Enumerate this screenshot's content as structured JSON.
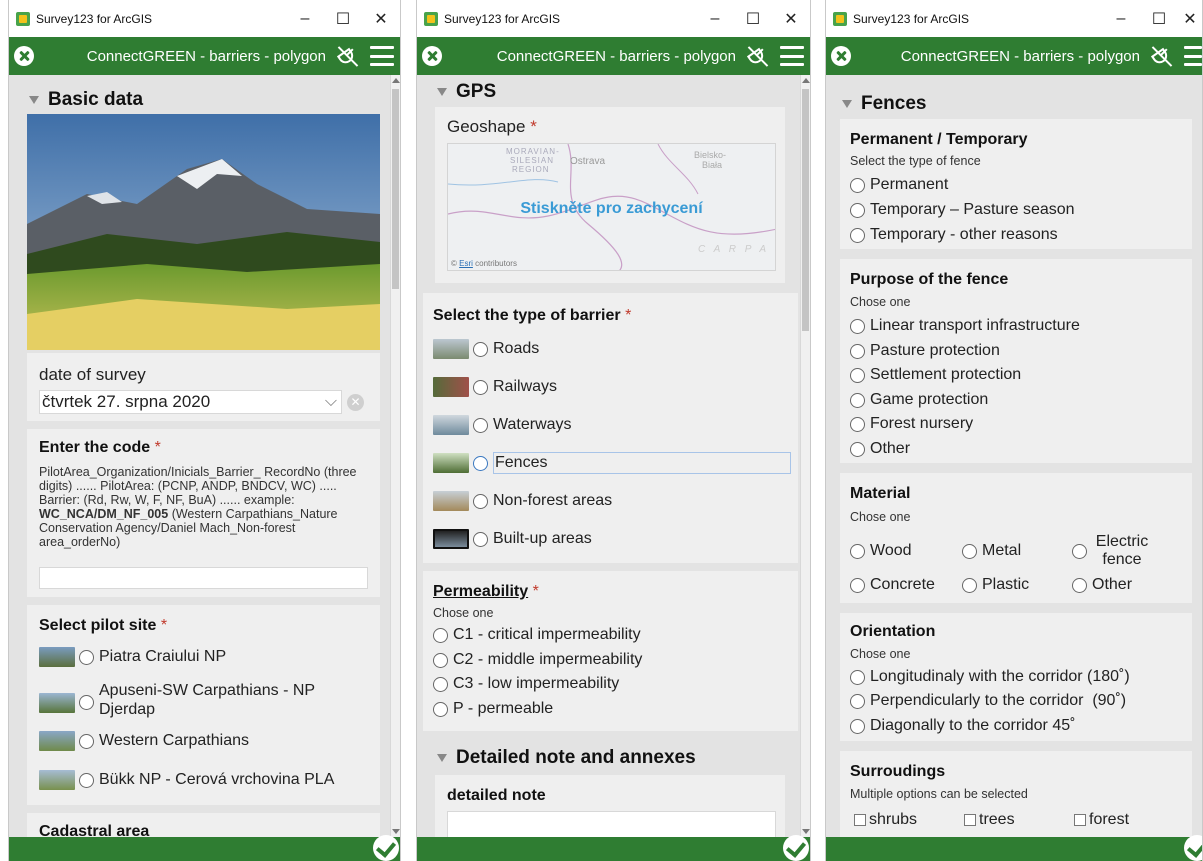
{
  "window1": {
    "title": "Survey123 for ArcGIS",
    "form_title": "ConnectGREEN - barriers - polygon",
    "group_basic": "Basic data",
    "date_label": "date of survey",
    "date_value": "čtvrtek 27. srpna 2020",
    "code_title": "Enter the code",
    "code_hint_1": "PilotArea_Organization/Inicials_Barrier_ RecordNo (three digits) ...... PilotArea: (PCNP, ANDP, BNDCV, WC) ..... Barrier: (Rd, Rw, W, F, NF, BuA) ...... example:",
    "code_hint_bold": "WC_NCA/DM_NF_005",
    "code_hint_2": "(Western Carpathians_Nature Conservation Agency/Daniel Mach_Non-forest area_orderNo)",
    "pilot_title": "Select pilot site",
    "pilot_options": [
      "Piatra Craiului NP",
      "Apuseni-SW Carpathians - NP Djerdap",
      "Western Carpathians",
      "Bükk NP - Cerová vrchovina PLA"
    ],
    "cadastral_label": "Cadastral area"
  },
  "window2": {
    "title": "Survey123 for ArcGIS",
    "form_title": "ConnectGREEN - barriers - polygon",
    "group_gps": "GPS",
    "geoshape_label": "Geoshape",
    "map_tap_text": "Stiskněte pro zachycení",
    "map_labels": [
      "MORAVIAN-",
      "SILESIAN",
      "REGION",
      "Ostrava",
      "Bielsko-",
      "Biała",
      "C A R P A"
    ],
    "map_credit_esri": "Esri",
    "map_credit_rest": "contributors",
    "barrier_title": "Select the type of barrier",
    "barrier_options": [
      "Roads",
      "Railways",
      "Waterways",
      "Fences",
      "Non-forest areas",
      "Built-up areas"
    ],
    "perm_title": "Permeability",
    "perm_hint": "Chose one",
    "perm_options": [
      "C1 - critical impermeability",
      "C2 - middle impermeability",
      "C3 - low impermeability",
      "P - permeable"
    ],
    "group_notes": "Detailed note and annexes",
    "note_label": "detailed note"
  },
  "window3": {
    "title": "Survey123 for ArcGIS",
    "form_title": "ConnectGREEN - barriers - polygon",
    "group_fences": "Fences",
    "pt_title": "Permanent / Temporary",
    "pt_hint": "Select the type of fence",
    "pt_options": [
      "Permanent",
      "Temporary – Pasture season",
      "Temporary - other reasons"
    ],
    "purpose_title": "Purpose of the fence",
    "purpose_hint": "Chose one",
    "purpose_options": [
      "Linear transport infrastructure",
      "Pasture protection",
      "Settlement protection",
      "Game protection",
      "Forest nursery",
      "Other"
    ],
    "material_title": "Material",
    "material_hint": "Chose one",
    "material_options": [
      "Wood",
      "Metal",
      "Electric fence",
      "Concrete",
      "Plastic",
      "Other"
    ],
    "orient_title": "Orientation",
    "orient_hint": "Chose one",
    "orient_options": [
      "Longitudinaly with the corridor (180˚)",
      "Perpendicularly to the corridor  (90˚)",
      "Diagonally to the corridor 45˚"
    ],
    "surr_title": "Surroudings",
    "surr_hint": "Multiple options can be selected",
    "surr_options": [
      "shrubs",
      "trees",
      "forest"
    ]
  },
  "colors": {
    "brand_green": "#2f7d32",
    "required": "#c0392b",
    "map_tap_text": "#3a9bd5"
  },
  "icons": [
    "close-icon",
    "gps-off-icon",
    "menu-icon",
    "submit-check-icon",
    "collapse-triangle-icon"
  ]
}
